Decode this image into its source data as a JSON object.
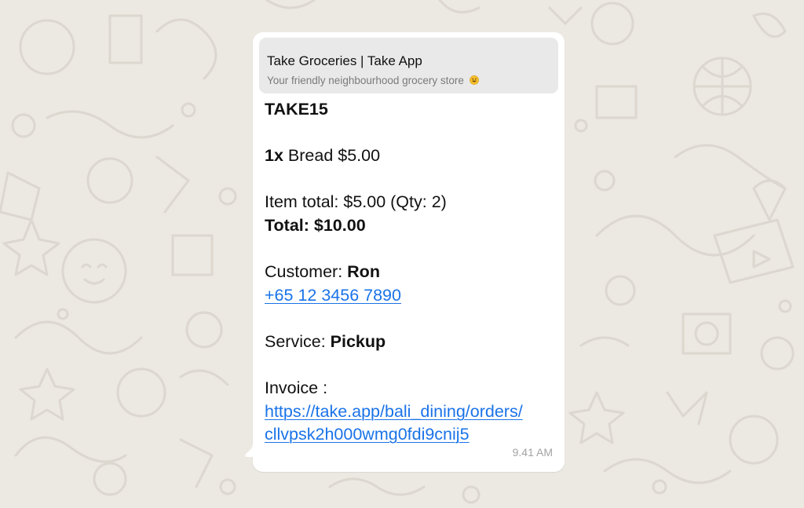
{
  "link_preview": {
    "title": "Take Groceries | Take App",
    "description": "Your friendly neighbourhood grocery store"
  },
  "message": {
    "promo_code": "TAKE15",
    "line_item": {
      "qty": "1x",
      "name_price": "Bread $5.00"
    },
    "item_total": "Item total: $5.00 (Qty: 2)",
    "total": "Total: $10.00",
    "customer_label": "Customer:",
    "customer_name": "Ron",
    "phone": "+65 12 3456 7890",
    "service_label": "Service:",
    "service_value": "Pickup",
    "invoice_label": "Invoice :",
    "invoice_url_line1": "https://take.app/bali_dining/orders/",
    "invoice_url_line2": "cllvpsk2h000wmg0fdi9cnij5",
    "timestamp": "9.41 AM"
  },
  "colors": {
    "background": "#ece8e2",
    "bubble": "#ffffff",
    "preview_card": "#e9e9e9",
    "link": "#1a73e8",
    "timestamp": "#a3a3a3"
  },
  "icons": {
    "preview_emoji": "grinning-face-emoji",
    "wallpaper": "doodle-pattern"
  }
}
